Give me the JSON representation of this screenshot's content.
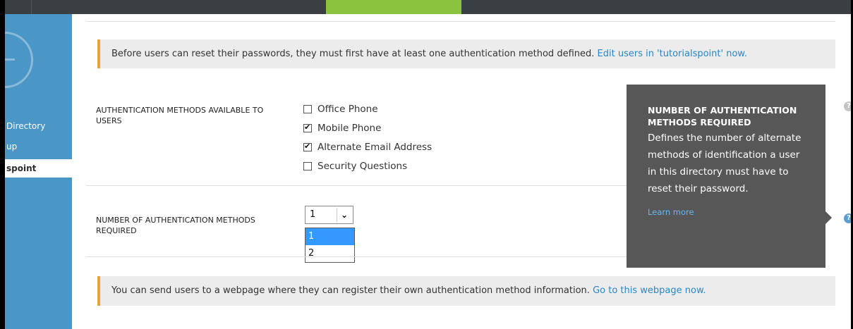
{
  "sidebar": {
    "items": [
      {
        "label": "Directory"
      },
      {
        "label": "up"
      },
      {
        "label": "spoint"
      }
    ]
  },
  "banners": {
    "top": {
      "text": "Before users can reset their passwords, they must first have at least one authentication method defined.",
      "link": "Edit users in 'tutorialspoint' now."
    },
    "bottom": {
      "text": "You can send users to a webpage where they can register their own authentication method information.",
      "link": "Go to this webpage now."
    }
  },
  "auth_methods": {
    "label": "AUTHENTICATION METHODS AVAILABLE TO USERS",
    "options": [
      {
        "label": "Office Phone",
        "checked": false
      },
      {
        "label": "Mobile Phone",
        "checked": true
      },
      {
        "label": "Alternate Email Address",
        "checked": true
      },
      {
        "label": "Security Questions",
        "checked": false
      }
    ]
  },
  "num_required": {
    "label": "NUMBER OF AUTHENTICATION METHODS REQUIRED",
    "selected": "1",
    "options": [
      "1",
      "2"
    ]
  },
  "tooltip": {
    "title": "NUMBER OF AUTHENTICATION METHODS REQUIRED",
    "body": "Defines the number of alternate methods of identification a user in this directory must have to reset their password.",
    "link": "Learn more"
  },
  "help_glyph": "?",
  "colors": {
    "sidebar": "#4a96c6",
    "accent_tab": "#8ac43f",
    "banner_stripe": "#e6a23c",
    "link": "#2a86c5",
    "tooltip_bg": "#575757",
    "dropdown_selected": "#3399ff"
  }
}
